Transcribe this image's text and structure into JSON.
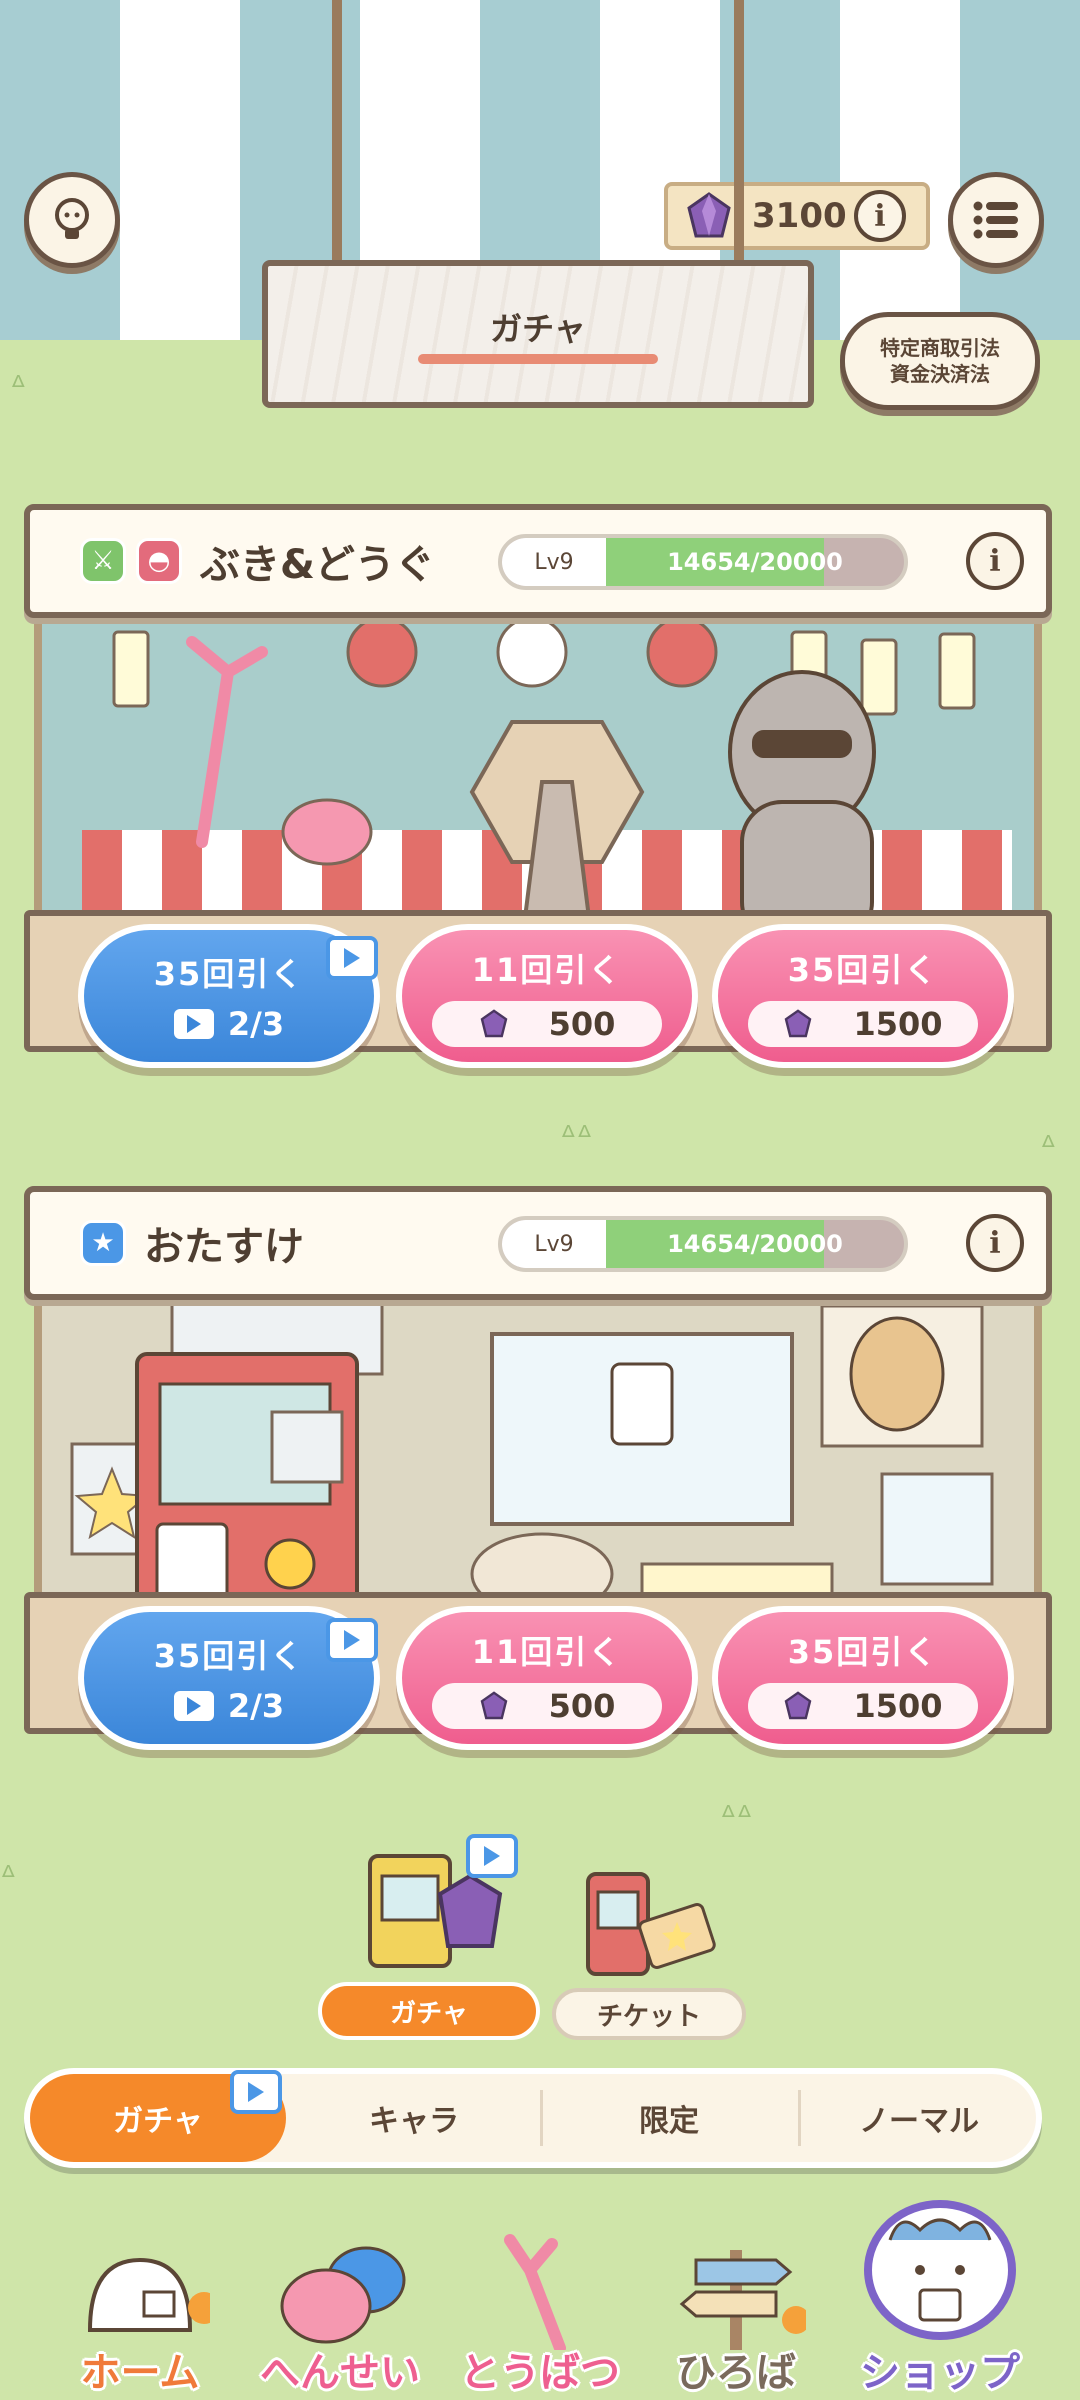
{
  "header": {
    "gems": "3100",
    "sign_title": "ガチャ",
    "legal_line1": "特定商取引法",
    "legal_line2": "資金決済法",
    "icons": {
      "hint": "lightbulb-icon",
      "menu": "list-menu-icon",
      "gem": "purple-gem-icon",
      "info": "info-icon"
    }
  },
  "booths": [
    {
      "title": "ぶき&どうぐ",
      "level": "Lv9",
      "exp": "14654/20000",
      "exp_fraction": 0.73,
      "ad_pull": {
        "label": "35回引く",
        "sub": "2/3"
      },
      "pull_11": {
        "label": "11回引く",
        "cost": "500"
      },
      "pull_35": {
        "label": "35回引く",
        "cost": "1500"
      }
    },
    {
      "title": "おたすけ",
      "level": "Lv9",
      "exp": "14654/20000",
      "exp_fraction": 0.73,
      "ad_pull": {
        "label": "35回引く",
        "sub": "2/3"
      },
      "pull_11": {
        "label": "11回引く",
        "cost": "500"
      },
      "pull_35": {
        "label": "35回引く",
        "cost": "1500"
      }
    }
  ],
  "sub_tabs": {
    "gacha": "ガチャ",
    "ticket": "チケット"
  },
  "category_tabs": [
    "ガチャ",
    "キャラ",
    "限定",
    "ノーマル"
  ],
  "bottom_nav": [
    "ホーム",
    "へんせい",
    "とうばつ",
    "ひろば",
    "ショップ"
  ],
  "colors": {
    "accent": "#f5892a",
    "blue_button": "#3b86d9",
    "pink_button": "#ef5d8e",
    "exp_fill": "#8fd07a"
  }
}
